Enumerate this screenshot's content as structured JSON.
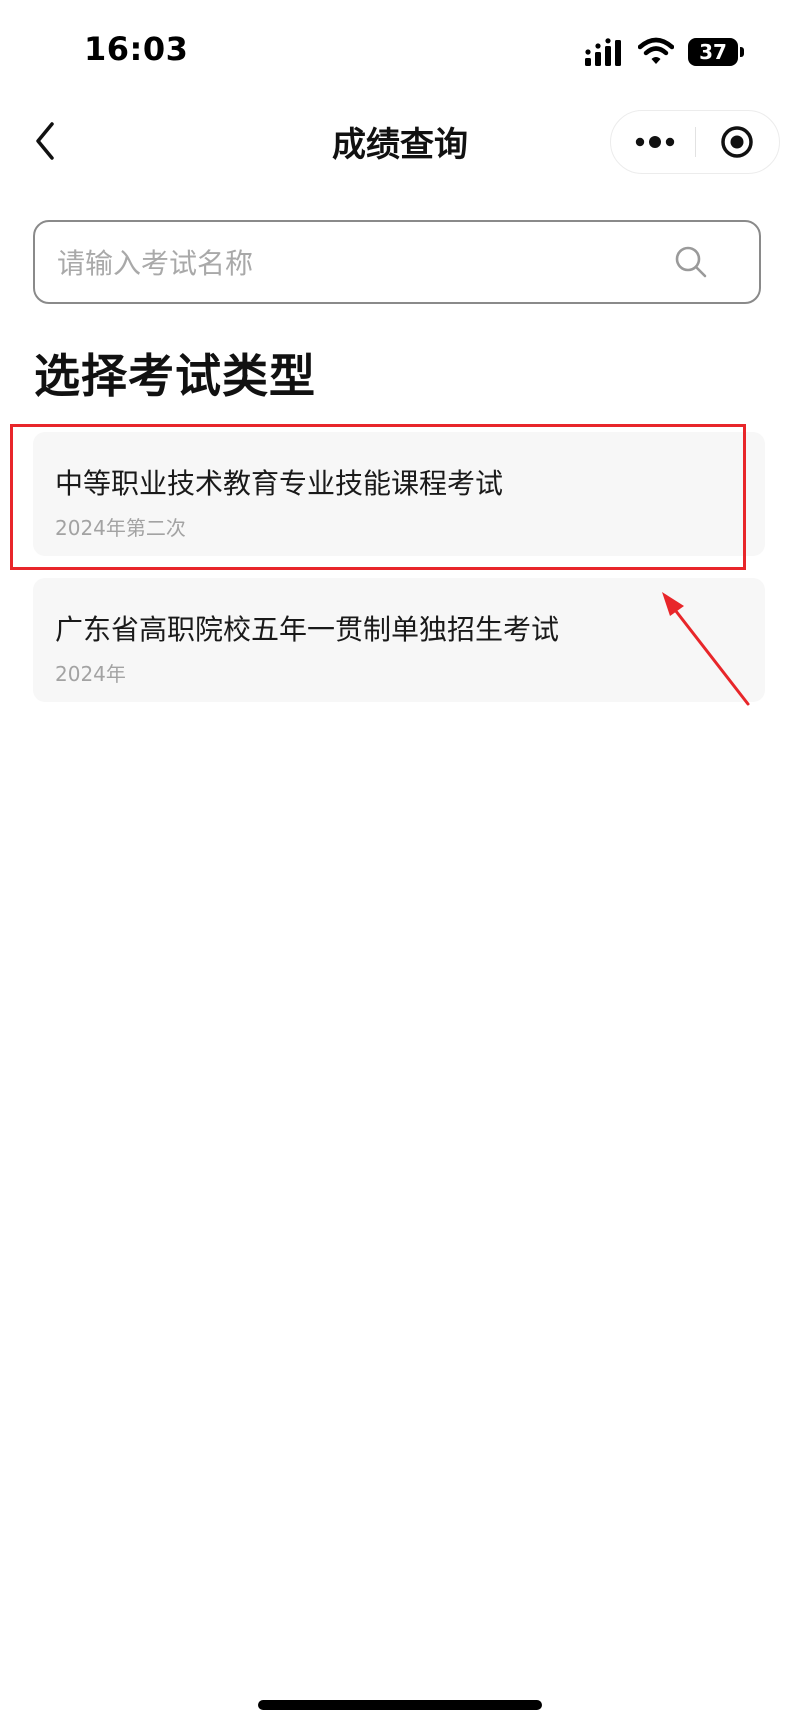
{
  "status_bar": {
    "time": "16:03",
    "battery_level": "37",
    "icons": [
      "signal-icon",
      "wifi-icon",
      "battery-icon"
    ]
  },
  "nav": {
    "title": "成绩查询",
    "back_icon": "chevron-left-icon",
    "more_icon": "more-dots-icon",
    "close_icon": "target-circle-icon"
  },
  "search": {
    "placeholder": "请输入考试名称",
    "value": "",
    "icon": "search-icon"
  },
  "section": {
    "title": "选择考试类型"
  },
  "exams": [
    {
      "name": "中等职业技术教育专业技能课程考试",
      "year": "2024年第二次",
      "highlighted": true
    },
    {
      "name": "广东省高职院校五年一贯制单独招生考试",
      "year": "2024年",
      "highlighted": false
    }
  ],
  "colors": {
    "annotation": "#e8262a",
    "card_background": "#f7f7f7",
    "secondary_text": "#a3a3a3"
  }
}
